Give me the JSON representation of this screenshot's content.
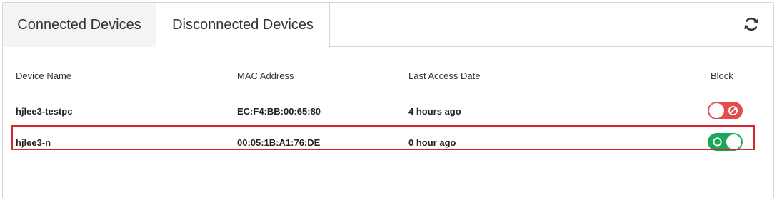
{
  "tabs": [
    {
      "label": "Connected Devices",
      "active": false
    },
    {
      "label": "Disconnected Devices",
      "active": true
    }
  ],
  "refresh_icon": "refresh-icon",
  "table": {
    "headers": {
      "device_name": "Device Name",
      "mac_address": "MAC Address",
      "last_access": "Last Access Date",
      "block": "Block"
    },
    "rows": [
      {
        "device_name": "hjlee3-testpc",
        "mac_address": "EC:F4:BB:00:65:80",
        "last_access": "4 hours ago",
        "block_state": "blocked",
        "block_color": "#e24c4b",
        "icon": "block-icon"
      },
      {
        "device_name": "hjlee3-n",
        "mac_address": "00:05:1B:A1:76:DE",
        "last_access": "0 hour ago",
        "block_state": "allowed",
        "block_color": "#1aa85a",
        "icon": "circle-icon",
        "highlighted": true
      }
    ]
  },
  "colors": {
    "highlight": "#d9232d",
    "border": "#d6d6d6"
  }
}
